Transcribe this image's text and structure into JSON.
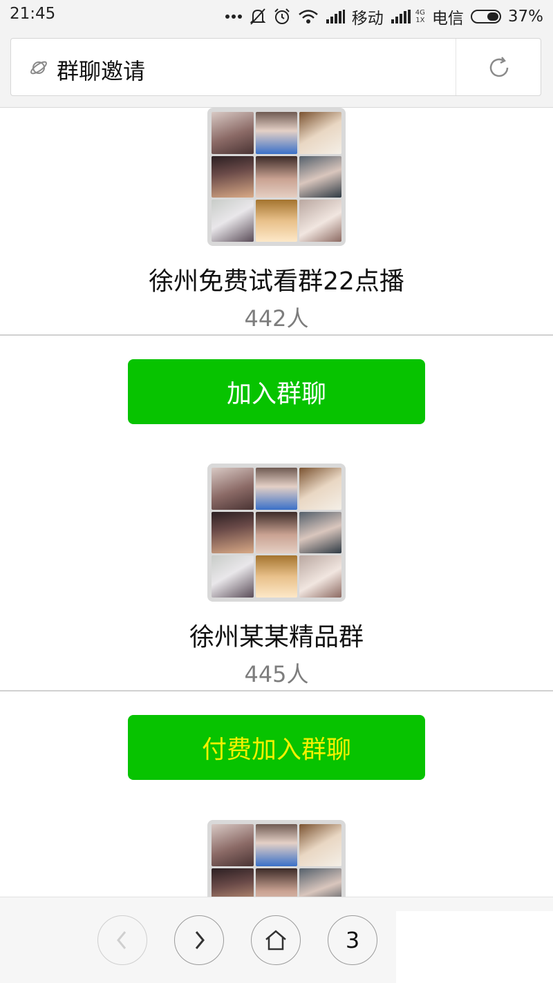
{
  "status_bar": {
    "time": "21:45",
    "carrier1": "移动",
    "net_top": "4G",
    "net_bottom": "1X",
    "carrier2": "电信",
    "battery": "37%"
  },
  "address_bar": {
    "title": "群聊邀请",
    "leading_icon": "planet-icon",
    "action_icon": "reload-icon"
  },
  "groups": [
    {
      "name": "徐州免费试看群22点播",
      "members": "442人",
      "button_label": "加入群聊"
    },
    {
      "name": "徐州某某精品群",
      "members": "445人",
      "button_label": "付费加入群聊"
    }
  ],
  "bottom_nav": {
    "back_icon": "chevron-left-icon",
    "forward_icon": "chevron-right-icon",
    "home_icon": "home-icon",
    "tab_count": "3"
  },
  "colors": {
    "button_green": "#07c300",
    "paid_label_yellow": "#f3f100",
    "muted_text": "#7d7d7d"
  }
}
